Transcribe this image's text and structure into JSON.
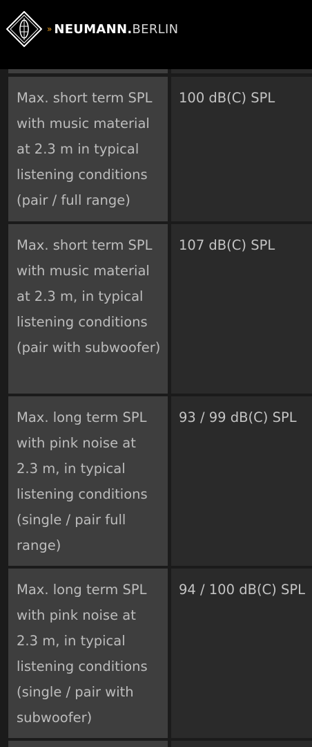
{
  "header": {
    "brand_prefix": "NEUMANN.",
    "brand_suffix": "BERLIN",
    "chevrons": "»"
  },
  "specs": {
    "rows": [
      {
        "label": "",
        "value": ""
      },
      {
        "label": "Max. short term SPL with music material at 2.3 m in typical listening conditions (pair / full range)",
        "value": "100 dB(C) SPL"
      },
      {
        "label": "Max. short term SPL with music material at 2.3 m, in typical listening conditions (pair with subwoofer)",
        "value": "107 dB(C) SPL"
      },
      {
        "label": "Max. long term SPL with pink noise at 2.3 m, in typical listening conditions (single / pair full range)",
        "value": "93 / 99 dB(C) SPL"
      },
      {
        "label": "Max. long term SPL with pink noise at 2.3 m, in typical listening conditions (single / pair with subwoofer)",
        "value": "94 / 100 dB(C) SPL"
      },
      {
        "label": "",
        "value": ""
      }
    ]
  },
  "colors": {
    "header_bg": "#000000",
    "accent": "#f0a020",
    "label_bg": "#3e3e3e",
    "value_bg": "#2a2a2a"
  }
}
